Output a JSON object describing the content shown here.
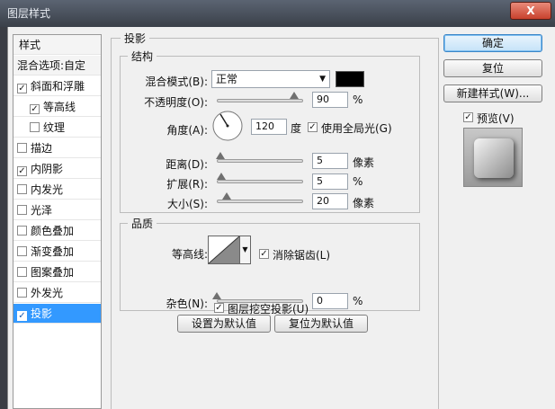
{
  "window": {
    "title": "图层样式",
    "close_label": "X"
  },
  "sidebar": {
    "header": "样式",
    "blend_options": "混合选项:自定",
    "items": [
      {
        "label": "斜面和浮雕",
        "checked": "✓"
      },
      {
        "label": "等高线",
        "checked": "✓"
      },
      {
        "label": "纹理",
        "checked": ""
      },
      {
        "label": "描边",
        "checked": ""
      },
      {
        "label": "内阴影",
        "checked": "✓"
      },
      {
        "label": "内发光",
        "checked": ""
      },
      {
        "label": "光泽",
        "checked": ""
      },
      {
        "label": "颜色叠加",
        "checked": ""
      },
      {
        "label": "渐变叠加",
        "checked": ""
      },
      {
        "label": "图案叠加",
        "checked": ""
      },
      {
        "label": "外发光",
        "checked": ""
      },
      {
        "label": "投影",
        "checked": "✓"
      }
    ]
  },
  "drop_shadow": {
    "title": "投影",
    "structure": {
      "title": "结构",
      "blend_mode_label": "混合模式(B):",
      "blend_mode_value": "正常",
      "shadow_color": "#000000",
      "opacity_label": "不透明度(O):",
      "opacity_value": "90",
      "opacity_unit": "%",
      "opacity_level": 0.9,
      "angle_label": "角度(A):",
      "angle_value": "120",
      "angle_unit": "度",
      "global_light_checked": "✓",
      "global_light_label": "使用全局光(G)",
      "distance_label": "距离(D):",
      "distance_value": "5",
      "distance_unit": "像素",
      "spread_label": "扩展(R):",
      "spread_value": "5",
      "spread_unit": "%",
      "size_label": "大小(S):",
      "size_value": "20",
      "size_unit": "像素"
    },
    "quality": {
      "title": "品质",
      "contour_label": "等高线:",
      "anti_alias_checked": "✓",
      "anti_alias_label": "消除锯齿(L)",
      "noise_label": "杂色(N):",
      "noise_value": "0",
      "noise_unit": "%"
    },
    "knockout_checked": "✓",
    "knockout_label": "图层挖空投影(U)",
    "set_default_label": "设置为默认值",
    "reset_default_label": "复位为默认值"
  },
  "buttons": {
    "ok": "确定",
    "reset": "复位",
    "new_style": "新建样式(W)...",
    "preview_checked": "✓",
    "preview_label": "预览(V)"
  },
  "colors": {
    "accent": "#3399ff",
    "dialog_bg": "#f0f0f0"
  }
}
